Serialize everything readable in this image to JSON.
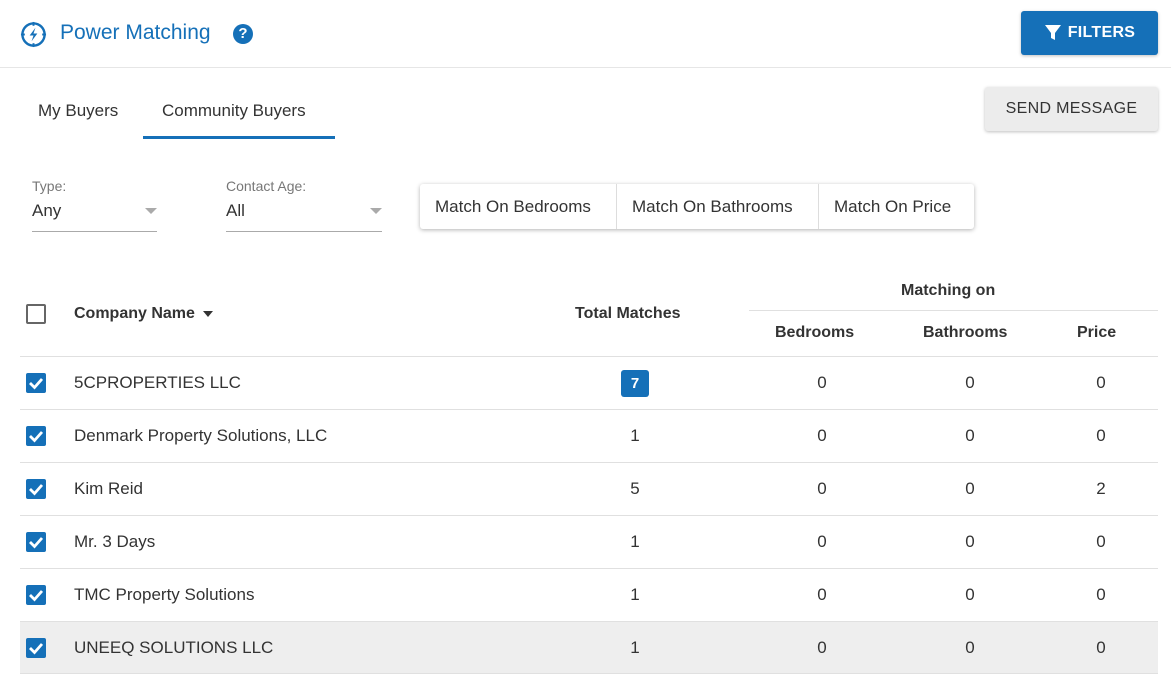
{
  "header": {
    "title": "Power Matching",
    "help_icon": "question-circle-icon",
    "logo_icon": "power-compass-icon",
    "filters_label": "FILTERS"
  },
  "tabs": [
    {
      "label": "My Buyers",
      "active": false
    },
    {
      "label": "Community Buyers",
      "active": true
    }
  ],
  "send_message_label": "SEND MESSAGE",
  "filters": {
    "type": {
      "label": "Type:",
      "value": "Any"
    },
    "contact_age": {
      "label": "Contact Age:",
      "value": "All"
    }
  },
  "match_toggles": [
    "Match On Bedrooms",
    "Match On Bathrooms",
    "Match On Price"
  ],
  "table": {
    "headers": {
      "company": "Company Name",
      "total": "Total Matches",
      "matching_on": "Matching on",
      "bedrooms": "Bedrooms",
      "bathrooms": "Bathrooms",
      "price": "Price"
    },
    "rows": [
      {
        "name": "5CPROPERTIES LLC",
        "total": "7",
        "bedrooms": "0",
        "bathrooms": "0",
        "price": "0",
        "checked": true
      },
      {
        "name": "Denmark Property Solutions, LLC",
        "total": "1",
        "bedrooms": "0",
        "bathrooms": "0",
        "price": "0",
        "checked": true
      },
      {
        "name": "Kim Reid",
        "total": "5",
        "bedrooms": "0",
        "bathrooms": "0",
        "price": "2",
        "checked": true
      },
      {
        "name": "Mr. 3 Days",
        "total": "1",
        "bedrooms": "0",
        "bathrooms": "0",
        "price": "0",
        "checked": true
      },
      {
        "name": "TMC Property Solutions",
        "total": "1",
        "bedrooms": "0",
        "bathrooms": "0",
        "price": "0",
        "checked": true
      },
      {
        "name": "UNEEQ SOLUTIONS LLC",
        "total": "1",
        "bedrooms": "0",
        "bathrooms": "0",
        "price": "0",
        "checked": true
      }
    ]
  },
  "colors": {
    "accent": "#1570b8",
    "row_highlight": "#eeeeee"
  }
}
